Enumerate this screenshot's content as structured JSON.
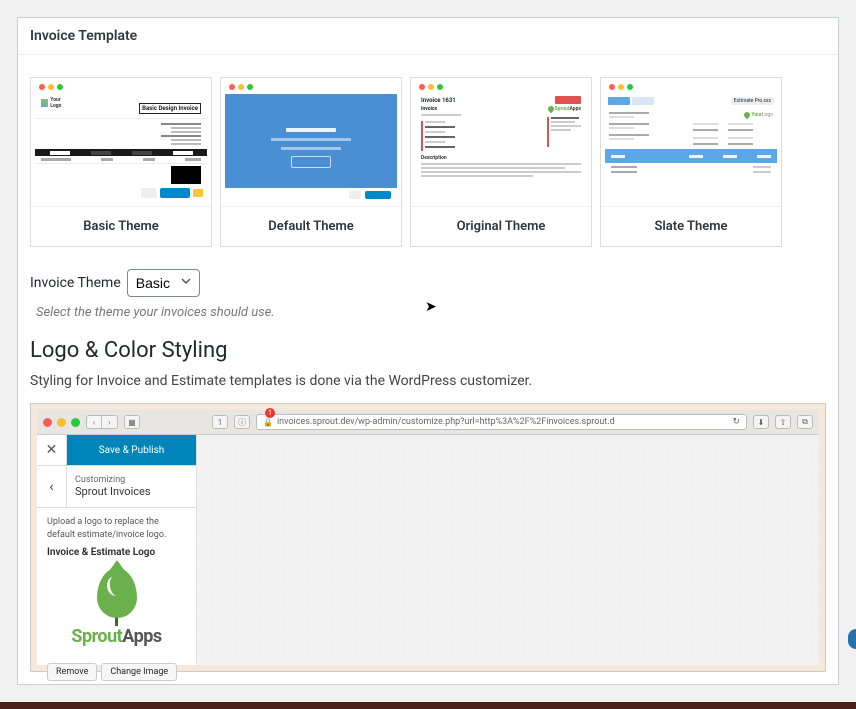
{
  "panel": {
    "title": "Invoice Template"
  },
  "themes": [
    {
      "name": "Basic Theme"
    },
    {
      "name": "Default Theme"
    },
    {
      "name": "Original Theme"
    },
    {
      "name": "Slate Theme"
    }
  ],
  "themeSelect": {
    "label": "Invoice Theme",
    "value": "Basic",
    "hint": "Select the theme your invoices should use."
  },
  "logoSection": {
    "heading": "Logo & Color Styling",
    "description": "Styling for Invoice and Estimate templates is done via the WordPress customizer."
  },
  "customizer": {
    "url": "invoices.sprout.dev/wp-admin/customize.php?url=http%3A%2F%2Finvoices.sprout.d",
    "notificationCount": "1",
    "saveLabel": "Save & Publish",
    "navSmall": "Customizing",
    "navMain": "Sprout Invoices",
    "helpText": "Upload a logo to replace the default estimate/invoice logo.",
    "logoLabel": "Invoice & Estimate Logo",
    "logoBrand1": "Sprout",
    "logoBrand2": "Apps",
    "removeBtn": "Remove",
    "changeBtn": "Change Image"
  },
  "original": {
    "invoiceNum": "Invoice 1631",
    "brand1": "Sprout",
    "brand2": "Apps",
    "descLabel": "Description"
  },
  "slate": {
    "badge": "Estimate Pro.xxx",
    "brand1": "Your",
    "brand2": "Logo"
  },
  "colors": {
    "primary": "#0085ba",
    "accent": "#6ab04c"
  }
}
